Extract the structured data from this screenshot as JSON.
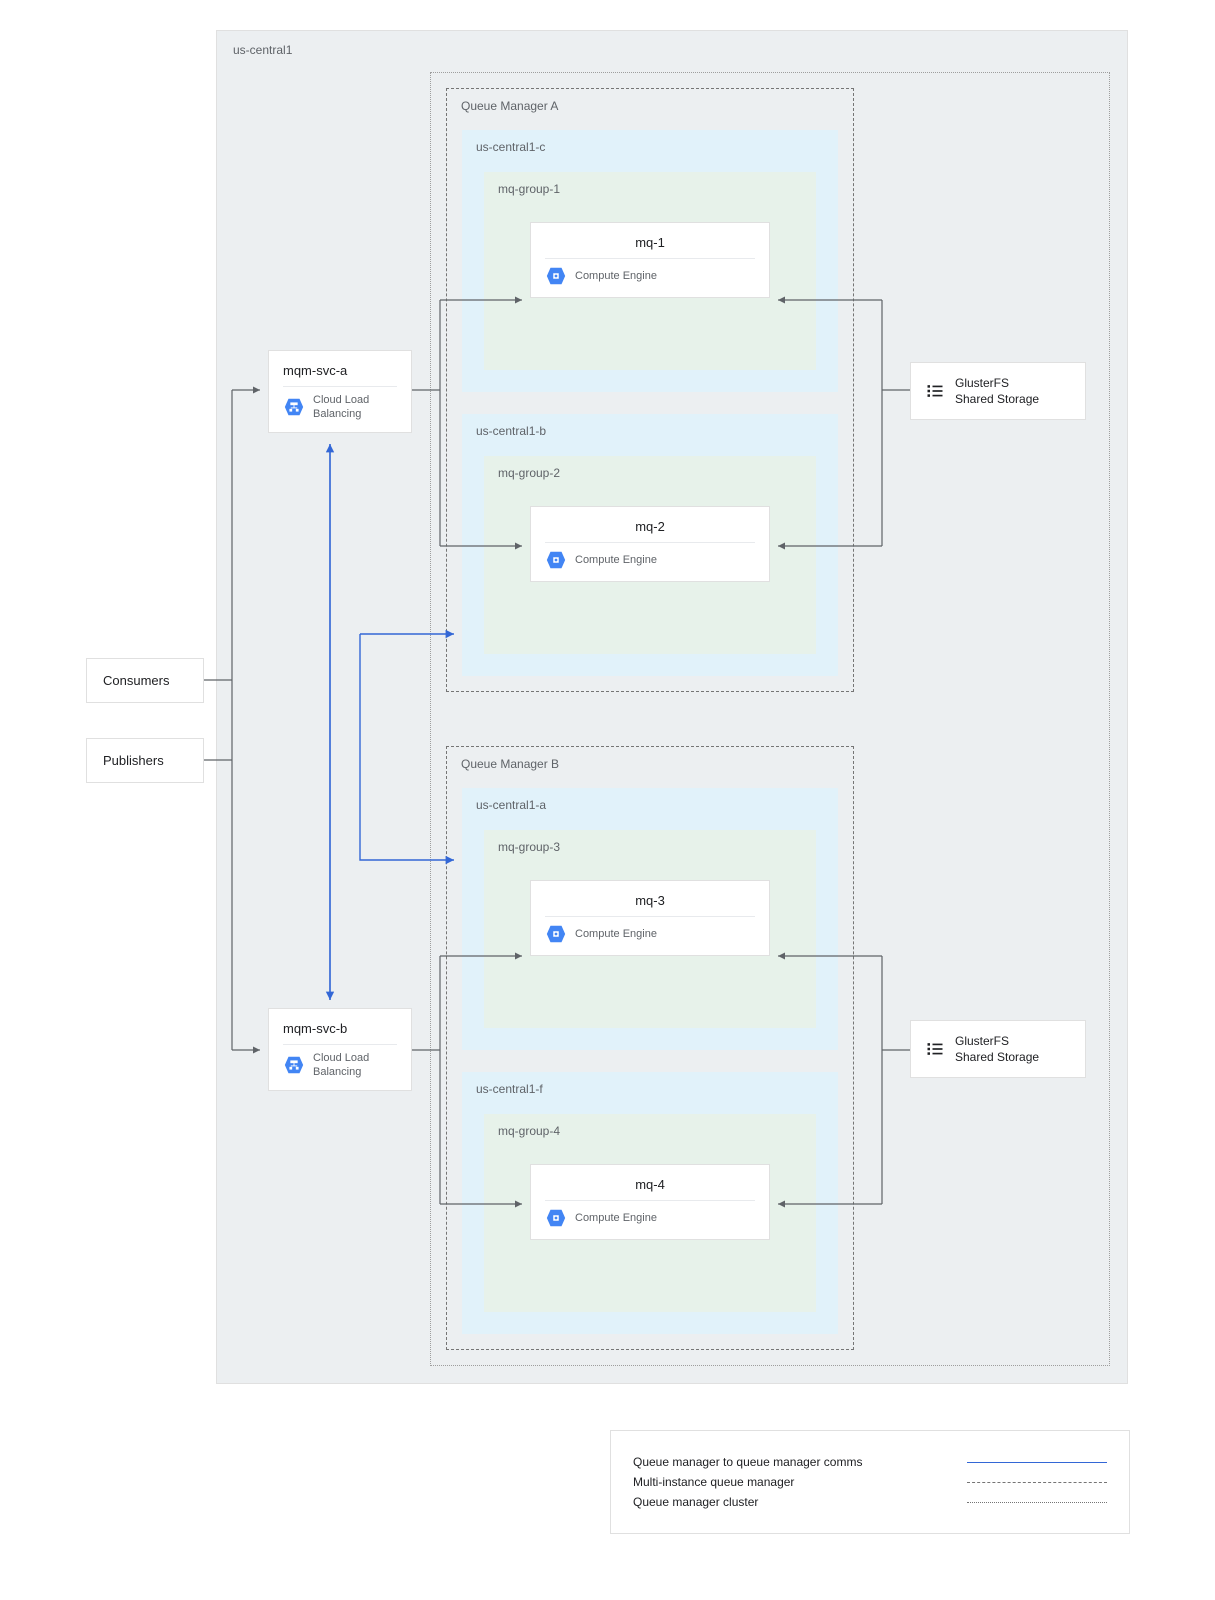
{
  "region": {
    "label": "us-central1"
  },
  "clients": {
    "consumers": "Consumers",
    "publishers": "Publishers"
  },
  "svc_a": {
    "title": "mqm-svc-a",
    "sub": "Cloud Load Balancing"
  },
  "svc_b": {
    "title": "mqm-svc-b",
    "sub": "Cloud Load Balancing"
  },
  "qm_a": {
    "label": "Queue Manager A",
    "zone1": {
      "label": "us-central1-c",
      "group": {
        "label": "mq-group-1",
        "node": {
          "title": "mq-1",
          "sub": "Compute Engine"
        }
      }
    },
    "zone2": {
      "label": "us-central1-b",
      "group": {
        "label": "mq-group-2",
        "node": {
          "title": "mq-2",
          "sub": "Compute Engine"
        }
      }
    }
  },
  "qm_b": {
    "label": "Queue Manager B",
    "zone1": {
      "label": "us-central1-a",
      "group": {
        "label": "mq-group-3",
        "node": {
          "title": "mq-3",
          "sub": "Compute Engine"
        }
      }
    },
    "zone2": {
      "label": "us-central1-f",
      "group": {
        "label": "mq-group-4",
        "node": {
          "title": "mq-4",
          "sub": "Compute Engine"
        }
      }
    }
  },
  "storage_a": {
    "line1": "GlusterFS",
    "line2": "Shared Storage"
  },
  "storage_b": {
    "line1": "GlusterFS",
    "line2": "Shared Storage"
  },
  "legend": {
    "row1": "Queue manager to queue manager comms",
    "row2": "Multi-instance queue manager",
    "row3": "Queue manager cluster"
  },
  "icons": {
    "lb": "cloud-load-balancing-icon",
    "ce": "compute-engine-icon",
    "storage": "storage-list-icon"
  }
}
